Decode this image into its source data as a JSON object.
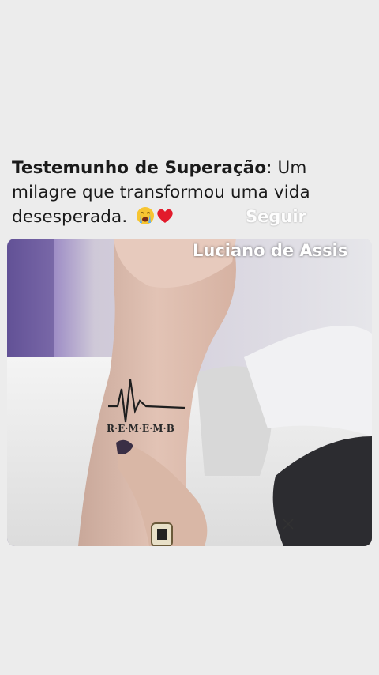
{
  "post": {
    "title_bold": "Testemunho de Superação",
    "title_rest": ": Um milagre que transformou uma vida desesperada.",
    "emojis": [
      "crying-face",
      "red-heart"
    ]
  },
  "overlay": {
    "follow_label": "Seguir",
    "author_name": "Luciano de Assis"
  },
  "video": {
    "tattoo_text": "R·E·M·E·M·B"
  },
  "colors": {
    "background": "#ececec",
    "text": "#1a1a1a",
    "overlay_text": "#ffffff"
  }
}
